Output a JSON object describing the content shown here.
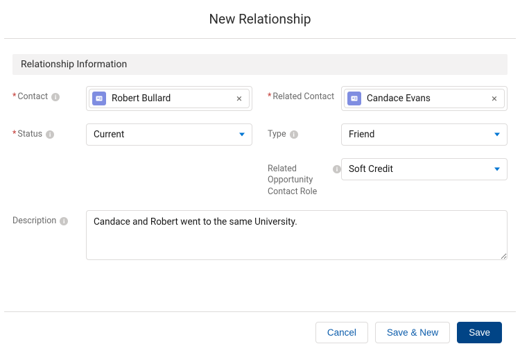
{
  "header": {
    "title": "New Relationship"
  },
  "section": {
    "title": "Relationship Information"
  },
  "labels": {
    "contact": "Contact",
    "related_contact": "Related Contact",
    "status": "Status",
    "type": "Type",
    "related_opp_role": "Related Opportunity Contact Role",
    "description": "Description"
  },
  "values": {
    "contact": "Robert Bullard",
    "related_contact": "Candace Evans",
    "status": "Current",
    "type": "Friend",
    "related_opp_role": "Soft Credit",
    "description": "Candace and Robert went to the same University."
  },
  "footer": {
    "cancel": "Cancel",
    "save_new": "Save & New",
    "save": "Save"
  }
}
